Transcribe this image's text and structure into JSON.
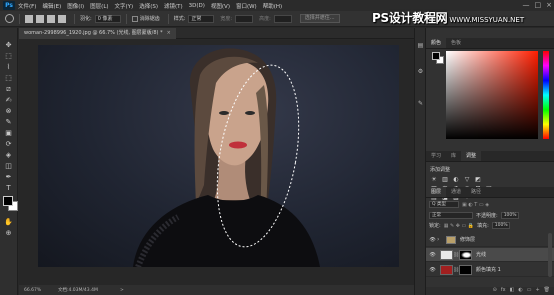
{
  "menu": {
    "logo": "Ps",
    "items": [
      "文件(F)",
      "编辑(E)",
      "图像(I)",
      "图层(L)",
      "文字(Y)",
      "选择(S)",
      "滤镜(T)",
      "3D(D)",
      "视图(V)",
      "窗口(W)",
      "帮助(H)"
    ],
    "window_controls": [
      "—",
      "□",
      "×"
    ]
  },
  "options": {
    "feather_label": "羽化:",
    "feather_value": "0 像素",
    "antialias_label": "消除锯齿",
    "style_label": "样式:",
    "style_value": "正常",
    "width_label": "宽度:",
    "height_label": "高度:",
    "select_mask_button": "选择并遮住..."
  },
  "watermark": {
    "brand": "PS设计教程网",
    "url": "WWW.MISSYUAN.NET"
  },
  "document": {
    "tab_title": "woman-2998996_1920.jpg @ 66.7% (光线, 图层蒙版/8) *",
    "close_glyph": "×",
    "selection_shape": "ellipse"
  },
  "status": {
    "zoom": "66.67%",
    "doc_size": "文档:4.03M/43.4M",
    "arrow": ">"
  },
  "color_panel": {
    "tabs": [
      "颜色",
      "色板"
    ],
    "foreground": "#000000",
    "background": "#ffffff",
    "picker_hue": "#ff1e00"
  },
  "adjust_panel": {
    "tabs": [
      "学习",
      "库",
      "调整"
    ],
    "title": "添加调整",
    "row1": [
      "☀",
      "▥",
      "◐",
      "▽",
      "◩"
    ],
    "row2": [
      "▦",
      "⚖",
      "◑",
      "◎",
      "⊞",
      "▣"
    ],
    "row3": [
      "▤",
      "◪",
      "▧",
      "⌗"
    ]
  },
  "layers_panel": {
    "tabs": [
      "图层",
      "通道",
      "路径"
    ],
    "filter_label": "Q 类型",
    "blend_mode": "正常",
    "opacity_label": "不透明度:",
    "opacity_value": "100%",
    "lock_label": "锁定:",
    "fill_label": "填充:",
    "fill_value": "100%",
    "layers": [
      {
        "name": "修饰层",
        "thumb_color": "#d8d8d8",
        "selected": false,
        "group": true
      },
      {
        "name": "光线",
        "thumb_color": "#ffffff",
        "selected": true,
        "group": false
      },
      {
        "name": "颜色填充 1",
        "thumb_color": "#a11f1f",
        "selected": false,
        "group": false
      }
    ],
    "bottom_icons": [
      "⊝",
      "fx",
      "◧",
      "◐",
      "▭",
      "+",
      "🗑"
    ]
  },
  "tools": [
    "✥",
    "⬚",
    "⌇",
    "⬚",
    "⧄",
    "✍",
    "⊗",
    "✎",
    "▣",
    "⟳",
    "◈",
    "◫",
    "✒",
    "T",
    "↖",
    "▭",
    "✋",
    "⊕"
  ]
}
